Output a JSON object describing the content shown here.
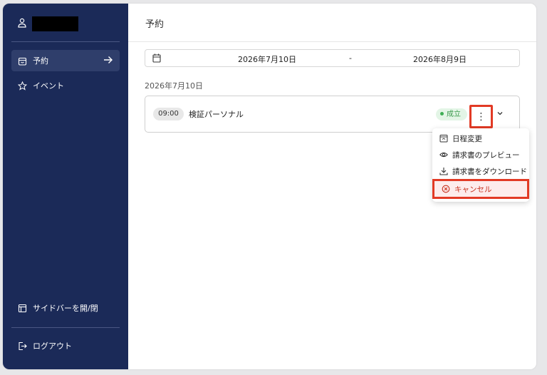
{
  "user": {
    "name": "████████"
  },
  "sidebar": {
    "items": [
      {
        "label": "予約",
        "icon": "calendar-bag-icon"
      },
      {
        "label": "イベント",
        "icon": "star-icon"
      }
    ],
    "toggle_label": "サイドバーを開/閉",
    "logout_label": "ログアウト"
  },
  "header": {
    "title": "予約"
  },
  "date_range": {
    "from": "2026年7月10日",
    "separator": "-",
    "to": "2026年8月9日"
  },
  "section": {
    "date_heading": "2026年7月10日"
  },
  "booking": {
    "time": "09:00",
    "title": "検証パーソナル",
    "status": "成立",
    "more": "⋮"
  },
  "menu": {
    "reschedule": "日程変更",
    "preview": "請求書のプレビュー",
    "download": "請求書をダウンロード",
    "cancel": "キャンセル"
  },
  "colors": {
    "sidebar_bg": "#1b2a58",
    "status_green": "#3fae55",
    "highlight_red": "#e23a25"
  }
}
